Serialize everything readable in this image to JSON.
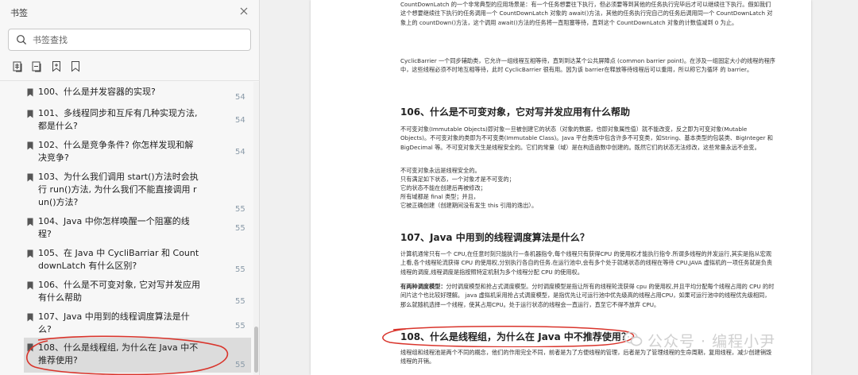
{
  "sidebar": {
    "title": "书签",
    "search_placeholder": "书签查找",
    "bookmarks": [
      {
        "text": "100、什么是并发容器的实现?",
        "page": "54"
      },
      {
        "text": "101、多线程同步和互斥有几种实现方法, 都是什么?",
        "page": "54"
      },
      {
        "text": "102、什么是竞争条件? 你怎样发现和解决竞争?",
        "page": "54"
      },
      {
        "text": "103、为什么我们调用 start()方法时会执行 run()方法, 为什么我们不能直接调用 run()方法?",
        "page": "55"
      },
      {
        "text": "104、Java 中你怎样唤醒一个阻塞的线程?",
        "page": "55"
      },
      {
        "text": "105、在 Java 中 CycliBarriar 和 CountdownLatch 有什么区别?",
        "page": "55"
      },
      {
        "text": "106、什么是不可变对象, 它对写并发应用有什么帮助",
        "page": "55"
      },
      {
        "text": "107、Java 中用到的线程调度算法是什么?",
        "page": "55"
      },
      {
        "text": "108、什么是线程组, 为什么在 Java 中不推荐使用?",
        "page": "55"
      }
    ]
  },
  "document": {
    "para_countdown": "CountDownLatch 的一个非常典型的应用场景是：有一个任务想要往下执行，但必须要等到其他的任务执行完毕后才可以继续往下执行。假如我们这个想要继续往下执行的任务调用一个 CountDownLatch 对象的 await()方法，其他的任务执行完自己的任务后调用同一个 CountDownLatch 对象上的 countDown()方法，这个调用 await()方法的任务将一直阻塞等待，直到这个 CountDownLatch 对象的计数值减到 0 为止。",
    "para_cyclic": "CyclicBarrier 一个同步辅助类，它允许一组线程互相等待，直到到达某个公共屏障点 (common barrier point)。在涉及一组固定大小的线程的程序中，这些线程必须不时地互相等待，此时 CyclicBarrier 很有用。因为该 barrier在释放等待线程后可以重用，所以称它为循环 的 barrier。",
    "h106": "106、什么是不可变对象，它对写并发应用有什么帮助",
    "para_immutable": "不可变对象(Immutable Objects)即对象一旦被创建它的状态（对象的数据，也即对象属性值）就不能改变，反之即为可变对象(Mutable Objects)。不可变对象的类即为不可变类(Immutable Class)。Java 平台类库中包含许多不可变类，如String、基本类型的包装类、BigInteger 和 BigDecimal 等。不可变对象天生是线程安全的。它们的常量（域）是在构造函数中创建的。既然它们的状态无法修改，这些常量永远不会变。",
    "line_i1": "不可变对象永远是线程安全的。",
    "line_i2": "只有满足如下状态，一个对象才是不可变的；",
    "line_i3": "它的状态不能在创建后再被修改；",
    "line_i4": "所有域都是 final 类型；并且，",
    "line_i5": "它被正确创建（创建期间没有发生 this 引用的逸出）。",
    "h107": "107、Java 中用到的线程调度算法是什么？",
    "para_sched1": "计算机通常只有一个 CPU,在任意时刻只能执行一条机器指令,每个线程只有获得CPU 的使用权才能执行指令.所谓多线程的并发运行,其实是指从宏观上看,各个线程轮流获得 CPU 的使用权,分别执行各自的任务.在运行池中,会有多个处于就绪状态的线程在等待 CPU,JAVA 虚拟机的一项任务就是负责线程的调度,线程调度是指按照特定机制为多个线程分配 CPU 的使用权。",
    "para_sched2_bold": "有两种调度模型：",
    "para_sched2": "分时调度模型和抢占式调度模型。分时调度模型是指让所有的线程轮流获得 cpu 的使用权,并且平均分配每个线程占用的 CPU 的时间片这个也比较好理解。 java 虚拟机采用抢占式调度模型，是指优先让可运行池中优先级高的线程占用CPU，如果可运行池中的线程优先级相同，那么就随机选择一个线程，使其占用CPU。处于运行状态的线程会一直运行，直至它不得不放弃 CPU。",
    "h108": "108、什么是线程组，为什么在 Java 中不推荐使用？",
    "para_group": "线程组和线程池是两个不同的概念，他们的作用完全不同，前者是为了方便线程的管理，后者是为了管理线程的生命周期，复用线程，减少创建销毁线程的开销。"
  },
  "watermark": {
    "text": "公众号 · 编程小尹"
  },
  "colors": {
    "annotation": "#d9342b",
    "page_number": "#8a9aa8",
    "watermark": "#d0d0d0"
  }
}
